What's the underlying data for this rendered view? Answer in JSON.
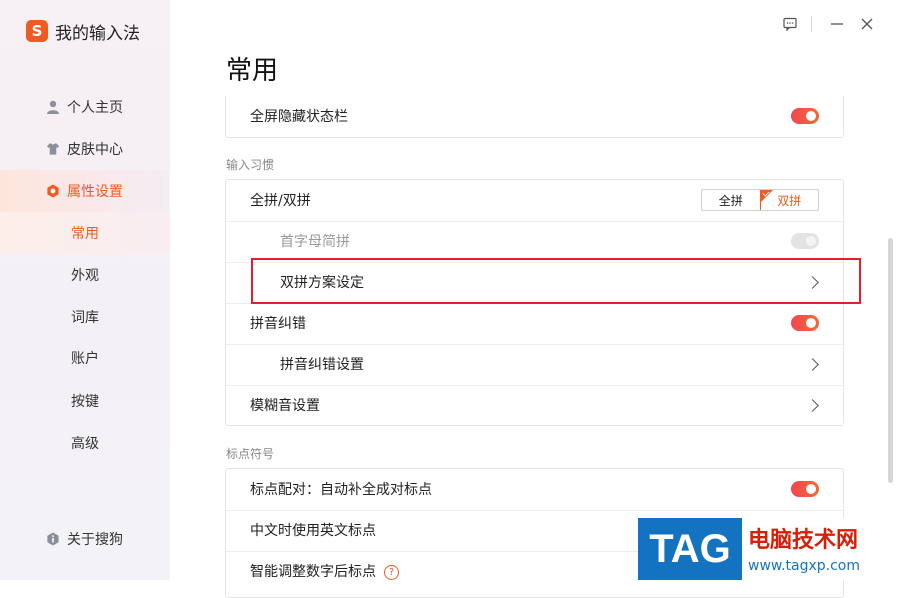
{
  "app": {
    "logo_letter": "S",
    "name": "我的输入法"
  },
  "window_buttons": [
    "feedback-icon",
    "minimize-icon",
    "close-icon"
  ],
  "sidebar": {
    "items": [
      {
        "label": "个人主页",
        "icon": "user-icon"
      },
      {
        "label": "皮肤中心",
        "icon": "shirt-icon"
      },
      {
        "label": "属性设置",
        "icon": "hexagon-gear-icon",
        "active": true
      }
    ],
    "subitems": [
      {
        "label": "常用",
        "active": true
      },
      {
        "label": "外观"
      },
      {
        "label": "词库"
      },
      {
        "label": "账户"
      },
      {
        "label": "按键"
      },
      {
        "label": "高级"
      }
    ],
    "about": {
      "label": "关于搜狗",
      "icon": "info-icon"
    }
  },
  "main": {
    "title": "常用",
    "top_row": {
      "label": "全屏隐藏状态栏",
      "toggle": "on"
    },
    "section_input": {
      "label": "输入习惯",
      "rows": {
        "quanpin": {
          "label": "全拼/双拼",
          "options": [
            "全拼",
            "双拼"
          ],
          "selected": "双拼"
        },
        "initials": {
          "label": "首字母简拼",
          "toggle": "off",
          "disabled": true
        },
        "shuangpin": {
          "label": "双拼方案设定"
        },
        "correction": {
          "label": "拼音纠错",
          "toggle": "on"
        },
        "correction_settings": {
          "label": "拼音纠错设置"
        },
        "fuzzy": {
          "label": "模糊音设置"
        }
      }
    },
    "section_punct": {
      "label": "标点符号",
      "rows": {
        "pairing": {
          "label": "标点配对：自动补全成对标点",
          "toggle": "on"
        },
        "english_punct": {
          "label": "中文时使用英文标点"
        },
        "smart_adjust": {
          "label": "智能调整数字后标点",
          "help": "?"
        }
      }
    }
  },
  "watermark": {
    "tag": "TAG",
    "cn": "电脑技术网",
    "url": "www.tagxp.com"
  },
  "colors": {
    "accent": "#f05a23",
    "toggle_on": "#f3464f",
    "highlight_box": "#e0202b",
    "watermark_blue": "#1473c0"
  }
}
